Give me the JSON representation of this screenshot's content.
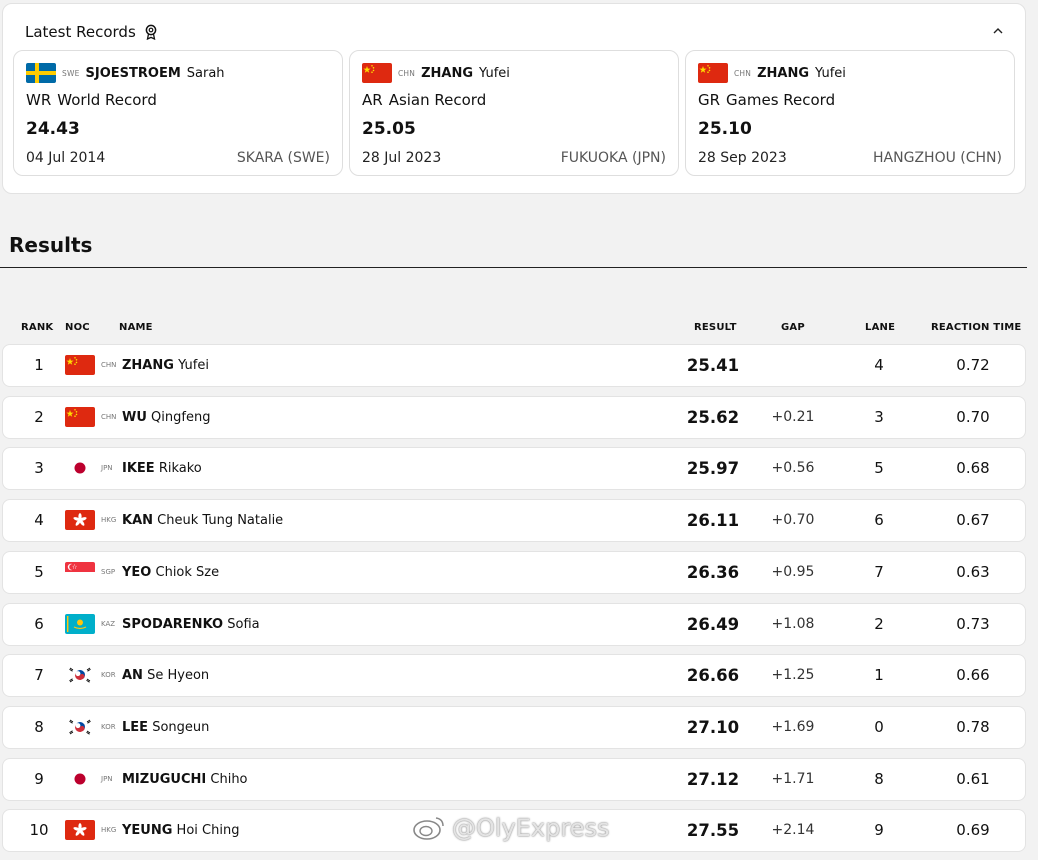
{
  "latest_records": {
    "title": "Latest Records",
    "records": [
      {
        "noc": "SWE",
        "surname": "SJOESTROEM",
        "given": "Sarah",
        "flag": "swe",
        "code": "WR",
        "label": "World Record",
        "value": "24.43",
        "date": "04 Jul 2014",
        "place": "SKARA (SWE)"
      },
      {
        "noc": "CHN",
        "surname": "ZHANG",
        "given": "Yufei",
        "flag": "chn",
        "code": "AR",
        "label": "Asian Record",
        "value": "25.05",
        "date": "28 Jul 2023",
        "place": "FUKUOKA (JPN)"
      },
      {
        "noc": "CHN",
        "surname": "ZHANG",
        "given": "Yufei",
        "flag": "chn",
        "code": "GR",
        "label": "Games Record",
        "value": "25.10",
        "date": "28 Sep 2023",
        "place": "HANGZHOU (CHN)"
      }
    ]
  },
  "results": {
    "title": "Results",
    "columns": {
      "rank": "RANK",
      "noc": "NOC",
      "name": "NAME",
      "result": "RESULT",
      "gap": "GAP",
      "lane": "LANE",
      "reaction": "REACTION TIME"
    },
    "rows": [
      {
        "rank": "1",
        "flag": "chn",
        "noc": "CHN",
        "surname": "ZHANG",
        "given": "Yufei",
        "result": "25.41",
        "gap": "",
        "lane": "4",
        "reaction": "0.72"
      },
      {
        "rank": "2",
        "flag": "chn",
        "noc": "CHN",
        "surname": "WU",
        "given": "Qingfeng",
        "result": "25.62",
        "gap": "+0.21",
        "lane": "3",
        "reaction": "0.70"
      },
      {
        "rank": "3",
        "flag": "jpn",
        "noc": "JPN",
        "surname": "IKEE",
        "given": "Rikako",
        "result": "25.97",
        "gap": "+0.56",
        "lane": "5",
        "reaction": "0.68"
      },
      {
        "rank": "4",
        "flag": "hkg",
        "noc": "HKG",
        "surname": "KAN",
        "given": "Cheuk Tung Natalie",
        "result": "26.11",
        "gap": "+0.70",
        "lane": "6",
        "reaction": "0.67"
      },
      {
        "rank": "5",
        "flag": "sgp",
        "noc": "SGP",
        "surname": "YEO",
        "given": "Chiok Sze",
        "result": "26.36",
        "gap": "+0.95",
        "lane": "7",
        "reaction": "0.63"
      },
      {
        "rank": "6",
        "flag": "kaz",
        "noc": "KAZ",
        "surname": "SPODARENKO",
        "given": "Sofia",
        "result": "26.49",
        "gap": "+1.08",
        "lane": "2",
        "reaction": "0.73"
      },
      {
        "rank": "7",
        "flag": "kor",
        "noc": "KOR",
        "surname": "AN",
        "given": "Se Hyeon",
        "result": "26.66",
        "gap": "+1.25",
        "lane": "1",
        "reaction": "0.66"
      },
      {
        "rank": "8",
        "flag": "kor",
        "noc": "KOR",
        "surname": "LEE",
        "given": "Songeun",
        "result": "27.10",
        "gap": "+1.69",
        "lane": "0",
        "reaction": "0.78"
      },
      {
        "rank": "9",
        "flag": "jpn",
        "noc": "JPN",
        "surname": "MIZUGUCHI",
        "given": "Chiho",
        "result": "27.12",
        "gap": "+1.71",
        "lane": "8",
        "reaction": "0.61"
      },
      {
        "rank": "10",
        "flag": "hkg",
        "noc": "HKG",
        "surname": "YEUNG",
        "given": "Hoi Ching",
        "result": "27.55",
        "gap": "+2.14",
        "lane": "9",
        "reaction": "0.69"
      }
    ]
  },
  "watermark": "@OlyExpress",
  "colors": {
    "chn_red": "#de2910",
    "swe_blue": "#006aa7",
    "swe_yellow": "#fecc00",
    "kaz_blue": "#00afca",
    "kaz_gold": "#fec50c"
  }
}
